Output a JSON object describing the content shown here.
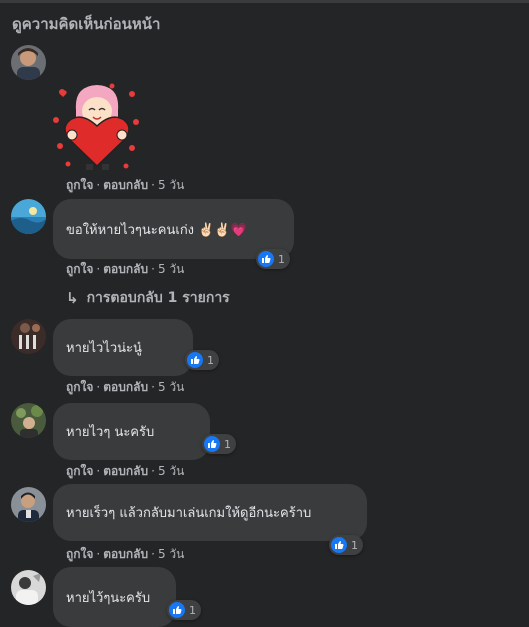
{
  "view_previous": "ดูความคิดเห็นก่อนหน้า",
  "comments": [
    {
      "text": "",
      "like": "ถูกใจ",
      "reply": "ตอบกลับ",
      "time": "5 วัน",
      "reactions": ""
    },
    {
      "text": "ขอให้หายไวๆนะคนเก่ง ✌🏻✌🏻💗",
      "like": "ถูกใจ",
      "reply": "ตอบกลับ",
      "time": "5 วัน",
      "reactions": "1"
    },
    {
      "text": "หายไวไวน่ะนู๋",
      "like": "ถูกใจ",
      "reply": "ตอบกลับ",
      "time": "5 วัน",
      "reactions": "1"
    },
    {
      "text": "หายไวๆ นะครับ",
      "like": "ถูกใจ",
      "reply": "ตอบกลับ",
      "time": "5 วัน",
      "reactions": "1"
    },
    {
      "text": "หายเร็วๆ แล้วกลับมาเล่นเกมให้ดูอีกนะคร้าบ",
      "like": "ถูกใจ",
      "reply": "ตอบกลับ",
      "time": "5 วัน",
      "reactions": "1"
    },
    {
      "text": "หายไว้ๆนะครับ",
      "like": "",
      "reply": "",
      "time": "",
      "reactions": "1"
    }
  ],
  "replies_link": "การตอบกลับ 1 รายการ",
  "separator": "·",
  "colors": {
    "background": "#242526",
    "bubble": "#3a3b3c",
    "like_blue": "#1877f2",
    "muted_text": "#b0b3b8"
  },
  "icons": [
    "thumbs-up-icon",
    "reply-arrow-icon",
    "sticker-heart-girl"
  ]
}
